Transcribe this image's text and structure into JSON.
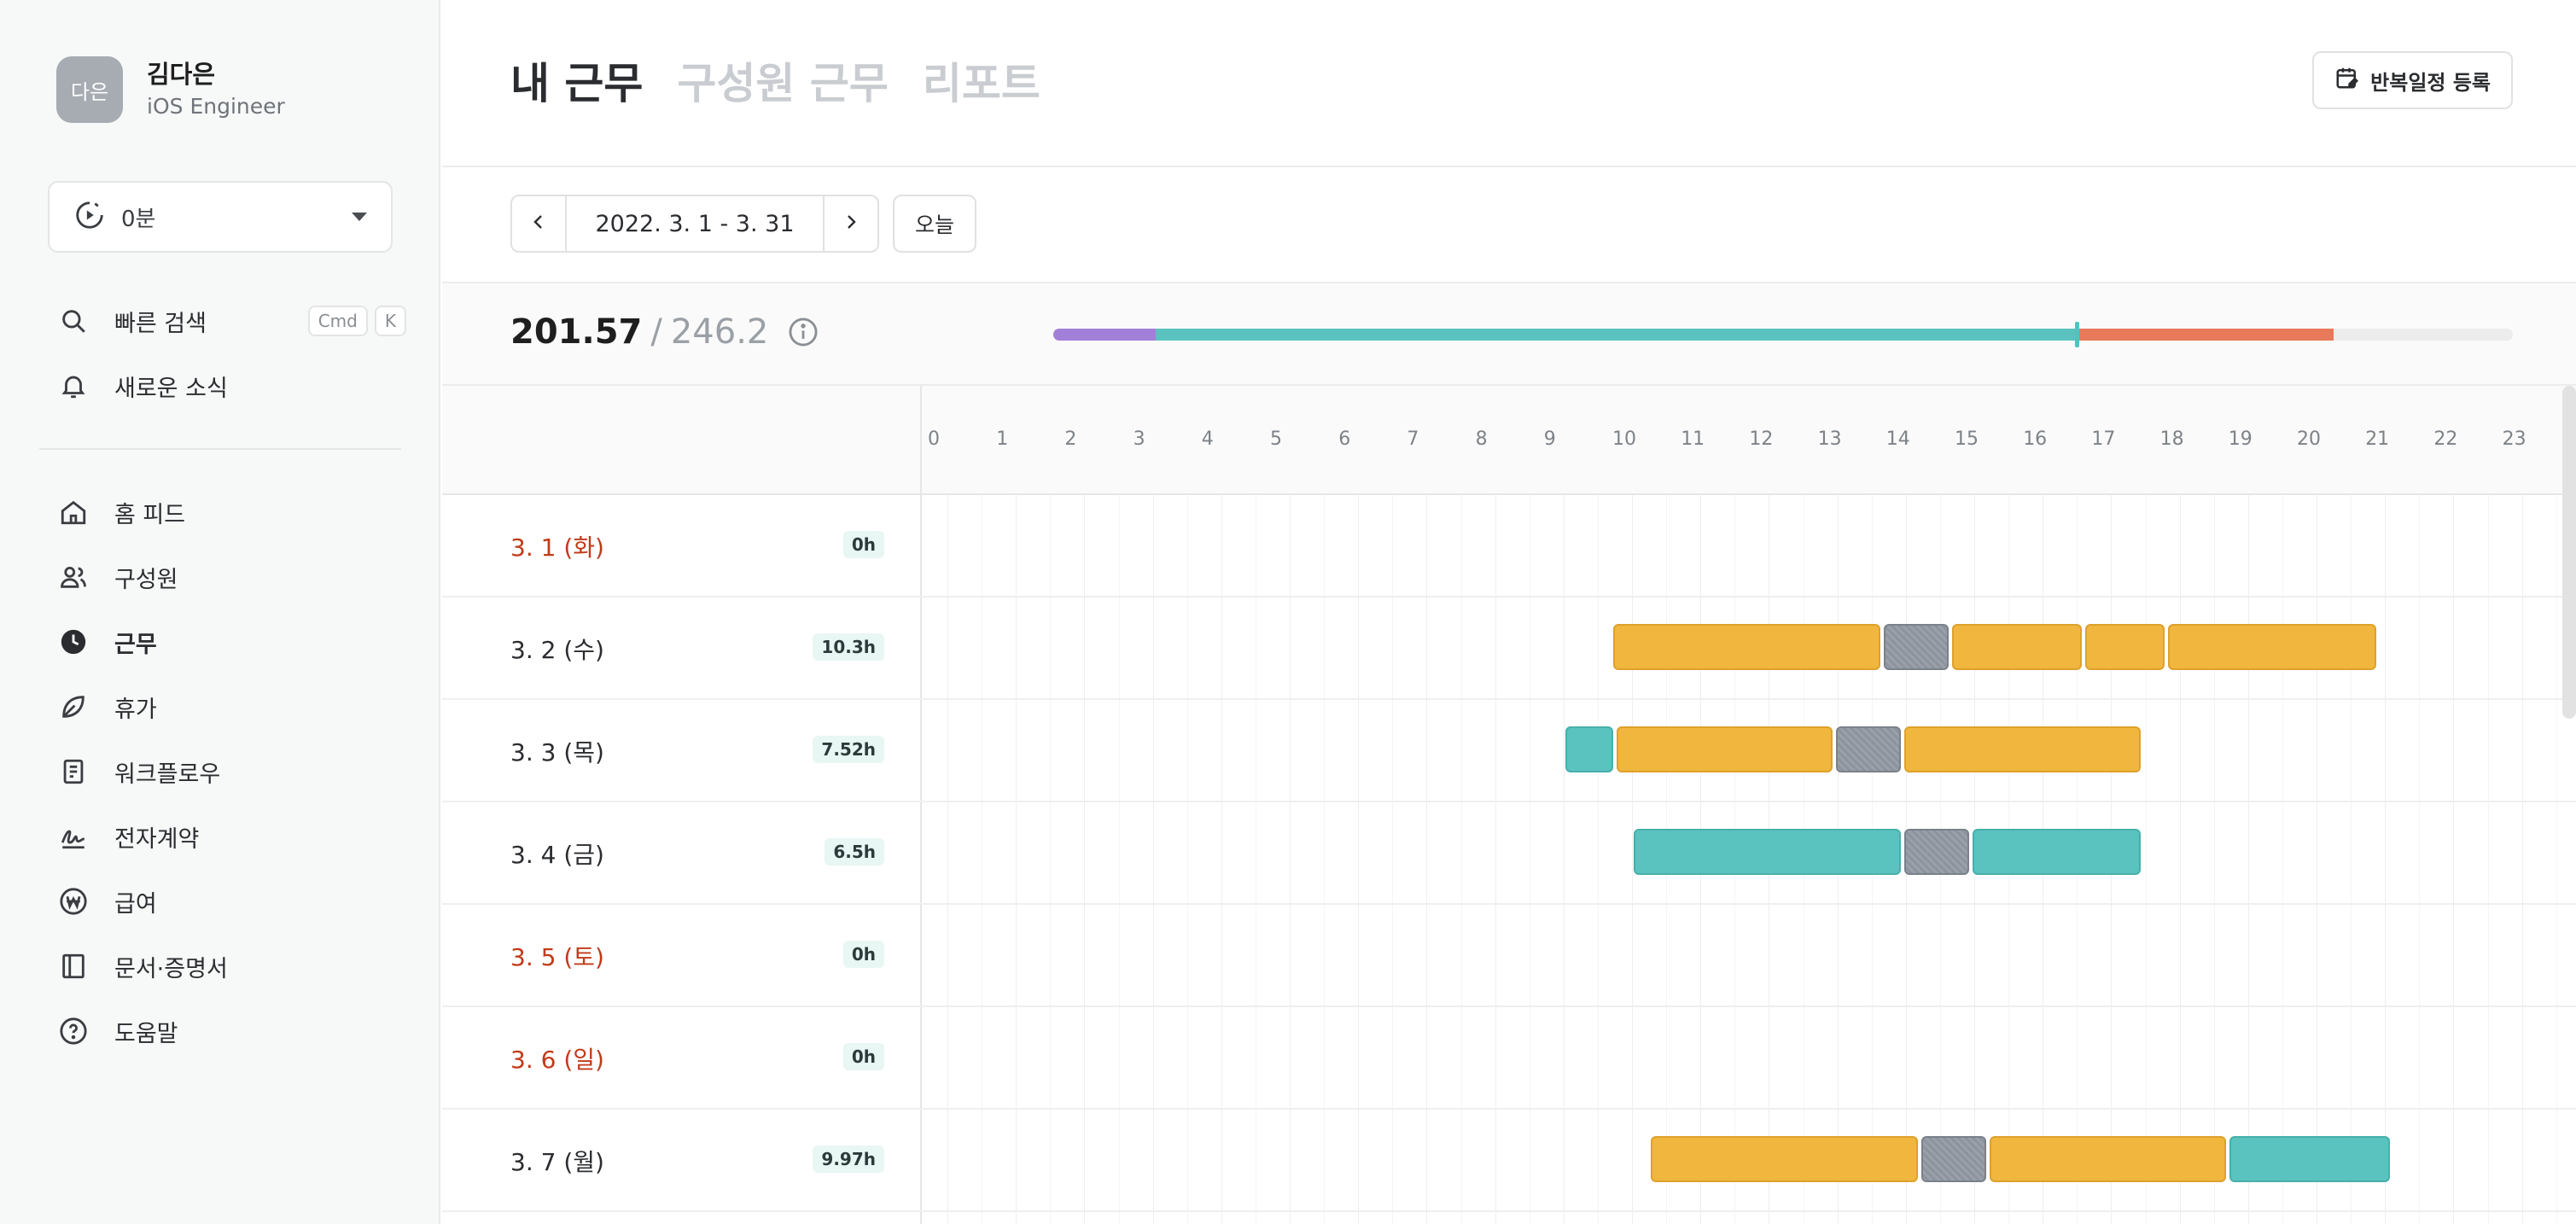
{
  "profile": {
    "avatar_text": "다은",
    "name": "김다은",
    "role": "iOS Engineer"
  },
  "timer": {
    "label": "0분"
  },
  "nav_top": [
    {
      "label": "빠른 검색",
      "icon": "search-icon",
      "shortcut": [
        "Cmd",
        "K"
      ]
    },
    {
      "label": "새로운 소식",
      "icon": "bell-icon"
    }
  ],
  "nav_main": [
    {
      "label": "홈 피드",
      "icon": "home-icon"
    },
    {
      "label": "구성원",
      "icon": "people-icon"
    },
    {
      "label": "근무",
      "icon": "clock-icon",
      "active": true
    },
    {
      "label": "휴가",
      "icon": "leaf-icon"
    },
    {
      "label": "워크플로우",
      "icon": "document-icon"
    },
    {
      "label": "전자계약",
      "icon": "signature-icon"
    },
    {
      "label": "급여",
      "icon": "won-icon"
    },
    {
      "label": "문서·증명서",
      "icon": "book-icon"
    },
    {
      "label": "도움말",
      "icon": "help-icon"
    }
  ],
  "tabs": [
    {
      "label": "내 근무",
      "active": true
    },
    {
      "label": "구성원 근무",
      "active": false
    },
    {
      "label": "리포트",
      "active": false
    }
  ],
  "repeat_button": {
    "label": "반복일정 등록"
  },
  "date_range": {
    "label": "2022. 3. 1 - 3. 31",
    "today_label": "오늘"
  },
  "summary": {
    "worked": "201.57",
    "separator": "/",
    "total": "246.2"
  },
  "progress": {
    "segments": [
      {
        "from": 0.0,
        "to": 0.07,
        "color": "#a27fd8"
      },
      {
        "from": 0.07,
        "to": 0.7,
        "color": "#5bc3bf"
      },
      {
        "from": 0.7,
        "to": 0.877,
        "color": "#e8795a"
      }
    ],
    "marker": 0.701
  },
  "hours": [
    "0",
    "1",
    "2",
    "3",
    "4",
    "5",
    "6",
    "7",
    "8",
    "9",
    "10",
    "11",
    "12",
    "13",
    "14",
    "15",
    "16",
    "17",
    "18",
    "19",
    "20",
    "21",
    "22",
    "23"
  ],
  "colors": {
    "work": "#f0b63d",
    "break": "#8c939d",
    "remote": "#5bc3bf",
    "holiday_text": "#c23a1a"
  },
  "rows": [
    {
      "date": "3. 1 (화)",
      "hours": "0h",
      "holiday": true,
      "blocks": []
    },
    {
      "date": "3. 2 (수)",
      "hours": "10.3h",
      "holiday": false,
      "blocks": [
        {
          "type": "work",
          "start": 9.95,
          "end": 13.9
        },
        {
          "type": "break",
          "start": 13.9,
          "end": 14.9
        },
        {
          "type": "work",
          "start": 14.9,
          "end": 16.85
        },
        {
          "type": "work",
          "start": 16.85,
          "end": 18.05
        },
        {
          "type": "work",
          "start": 18.05,
          "end": 21.15
        }
      ]
    },
    {
      "date": "3. 3 (목)",
      "hours": "7.52h",
      "holiday": false,
      "blocks": [
        {
          "type": "remote",
          "start": 9.25,
          "end": 10.0
        },
        {
          "type": "work",
          "start": 10.0,
          "end": 13.2
        },
        {
          "type": "break",
          "start": 13.2,
          "end": 14.2
        },
        {
          "type": "work",
          "start": 14.2,
          "end": 17.7
        }
      ]
    },
    {
      "date": "3. 4 (금)",
      "hours": "6.5h",
      "holiday": false,
      "blocks": [
        {
          "type": "remote",
          "start": 10.25,
          "end": 14.2
        },
        {
          "type": "break",
          "start": 14.2,
          "end": 15.2
        },
        {
          "type": "remote",
          "start": 15.2,
          "end": 17.7
        }
      ]
    },
    {
      "date": "3. 5 (토)",
      "hours": "0h",
      "holiday": true,
      "blocks": []
    },
    {
      "date": "3. 6 (일)",
      "hours": "0h",
      "holiday": true,
      "blocks": []
    },
    {
      "date": "3. 7 (월)",
      "hours": "9.97h",
      "holiday": false,
      "blocks": [
        {
          "type": "work",
          "start": 10.5,
          "end": 14.45
        },
        {
          "type": "break",
          "start": 14.45,
          "end": 15.45
        },
        {
          "type": "work",
          "start": 15.45,
          "end": 18.95
        },
        {
          "type": "remote",
          "start": 18.95,
          "end": 21.35
        }
      ]
    }
  ]
}
